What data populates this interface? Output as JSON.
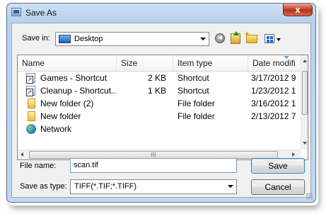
{
  "window": {
    "title": "Save As",
    "close_label": "x"
  },
  "toolbar": {
    "save_in_label": "Save in:",
    "location": "Desktop",
    "icons": [
      "back-icon",
      "up-folder-icon",
      "new-folder-icon",
      "views-icon"
    ]
  },
  "list": {
    "columns": [
      "Name",
      "Size",
      "Item type",
      "Date modifi"
    ],
    "rows": [
      {
        "name": "Games - Shortcut",
        "size": "2 KB",
        "type": "Shortcut",
        "date": "3/17/2012 9",
        "icon": "shortcut-icon"
      },
      {
        "name": "Cleanup - Shortcut...",
        "size": "1 KB",
        "type": "Shortcut",
        "date": "1/23/2012 1",
        "icon": "shortcut-icon"
      },
      {
        "name": "New folder (2)",
        "size": "",
        "type": "File folder",
        "date": "3/16/2012 1",
        "icon": "folder-icon"
      },
      {
        "name": "New folder",
        "size": "",
        "type": "File folder",
        "date": "2/13/2012 7",
        "icon": "folder-icon"
      },
      {
        "name": "Network",
        "size": "",
        "type": "",
        "date": "",
        "icon": "network-icon"
      }
    ],
    "hscroll_grip": "III"
  },
  "footer": {
    "filename_label": "File name:",
    "filename_value": "scan.tif",
    "type_label": "Save as type:",
    "type_value": "TIFF(*.TIF;*.TIFF)",
    "save_label": "Save",
    "cancel_label": "Cancel"
  }
}
